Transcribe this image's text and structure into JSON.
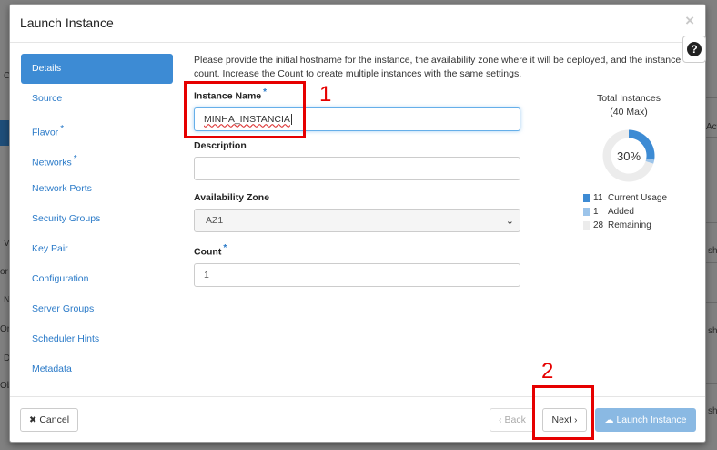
{
  "background": {
    "fragments": [
      "C",
      "V",
      "or",
      "N",
      "Ord",
      "D",
      "Ob",
      "Acti",
      "sho",
      "sho",
      "sho"
    ]
  },
  "modal": {
    "title": "Launch Instance",
    "close_glyph": "×",
    "help_glyph": "?"
  },
  "nav": {
    "items": [
      {
        "label": "Details",
        "required": false
      },
      {
        "label": "Source",
        "required": false
      },
      {
        "label": "Flavor",
        "required": true
      },
      {
        "label": "Networks",
        "required": true
      },
      {
        "label": "Network Ports",
        "required": false
      },
      {
        "label": "Security Groups",
        "required": false
      },
      {
        "label": "Key Pair",
        "required": false
      },
      {
        "label": "Configuration",
        "required": false
      },
      {
        "label": "Server Groups",
        "required": false
      },
      {
        "label": "Scheduler Hints",
        "required": false
      },
      {
        "label": "Metadata",
        "required": false
      }
    ],
    "required_marker": "*"
  },
  "details": {
    "help_text": "Please provide the initial hostname for the instance, the availability zone where it will be deployed, and the instance count. Increase the Count to create multiple instances with the same settings.",
    "instance_name": {
      "label": "Instance Name",
      "value": "MINHA_INSTANCIA"
    },
    "description": {
      "label": "Description",
      "value": ""
    },
    "availability_zone": {
      "label": "Availability Zone",
      "value": "AZ1"
    },
    "count": {
      "label": "Count",
      "value": "1"
    }
  },
  "chart_data": {
    "type": "pie",
    "title": "Total Instances",
    "subtitle": "(40 Max)",
    "center_label": "30%",
    "slices": [
      {
        "name": "Current Usage",
        "value": 11,
        "color": "#3d8bd4"
      },
      {
        "name": "Added",
        "value": 1,
        "color": "#9cc4ea"
      },
      {
        "name": "Remaining",
        "value": 28,
        "color": "#ececec"
      }
    ]
  },
  "footer": {
    "cancel_label": "Cancel",
    "back_label": "Back",
    "next_label": "Next",
    "launch_label": "Launch Instance"
  },
  "annotations": {
    "first_label": "1",
    "second_label": "2"
  }
}
